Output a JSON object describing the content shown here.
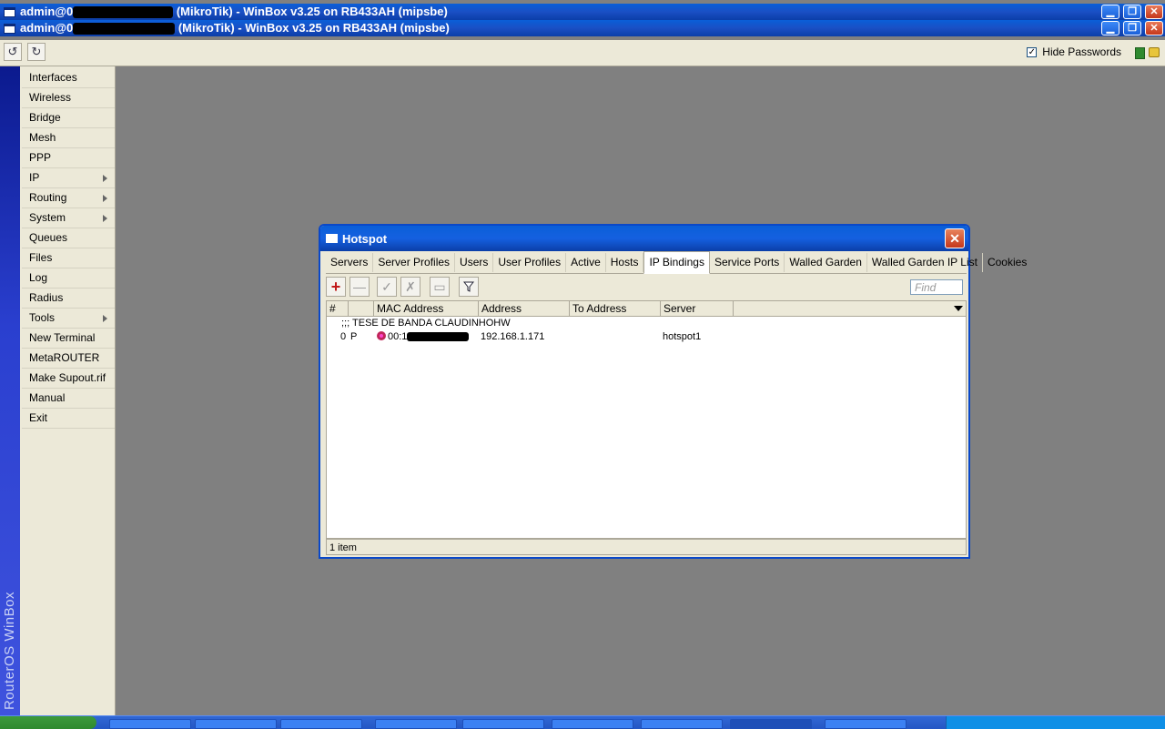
{
  "outer_window": {
    "title_prefix": "admin@0",
    "title_suffix": "(MikroTik) - WinBox v3.25 on RB433AH (mipsbe)"
  },
  "inner_window": {
    "title_prefix": "admin@0",
    "title_suffix": "(MikroTik) - WinBox v3.25 on RB433AH (mipsbe)"
  },
  "toolbar": {
    "undo_icon": "undo-icon",
    "redo_icon": "redo-icon",
    "hide_passwords_label": "Hide Passwords",
    "hide_passwords_checked": true
  },
  "sidebar": {
    "vertical_label": "RouterOS WinBox",
    "items": [
      {
        "label": "Interfaces",
        "submenu": false
      },
      {
        "label": "Wireless",
        "submenu": false
      },
      {
        "label": "Bridge",
        "submenu": false
      },
      {
        "label": "Mesh",
        "submenu": false
      },
      {
        "label": "PPP",
        "submenu": false
      },
      {
        "label": "IP",
        "submenu": true
      },
      {
        "label": "Routing",
        "submenu": true
      },
      {
        "label": "System",
        "submenu": true
      },
      {
        "label": "Queues",
        "submenu": false
      },
      {
        "label": "Files",
        "submenu": false
      },
      {
        "label": "Log",
        "submenu": false
      },
      {
        "label": "Radius",
        "submenu": false
      },
      {
        "label": "Tools",
        "submenu": true
      },
      {
        "label": "New Terminal",
        "submenu": false
      },
      {
        "label": "MetaROUTER",
        "submenu": false
      },
      {
        "label": "Make Supout.rif",
        "submenu": false
      },
      {
        "label": "Manual",
        "submenu": false
      },
      {
        "label": "Exit",
        "submenu": false
      }
    ]
  },
  "hotspot": {
    "title": "Hotspot",
    "tabs": [
      "Servers",
      "Server Profiles",
      "Users",
      "User Profiles",
      "Active",
      "Hosts",
      "IP Bindings",
      "Service Ports",
      "Walled Garden",
      "Walled Garden IP List",
      "Cookies"
    ],
    "active_tab": "IP Bindings",
    "find_placeholder": "Find",
    "columns": [
      "#",
      "",
      "MAC Address",
      "Address",
      "To Address",
      "Server"
    ],
    "comment": ";;; TESE DE BANDA CLAUDINHOHW",
    "rows": [
      {
        "num": "0",
        "flag": "P",
        "mac": "00:1",
        "address": "192.168.1.171",
        "to_address": "",
        "server": "hotspot1"
      }
    ],
    "status": "1 item"
  },
  "colors": {
    "title_blue": "#0a5fd8",
    "window_bg": "#ece9d8",
    "desktop": "#808080",
    "close_red": "#c5371b"
  }
}
